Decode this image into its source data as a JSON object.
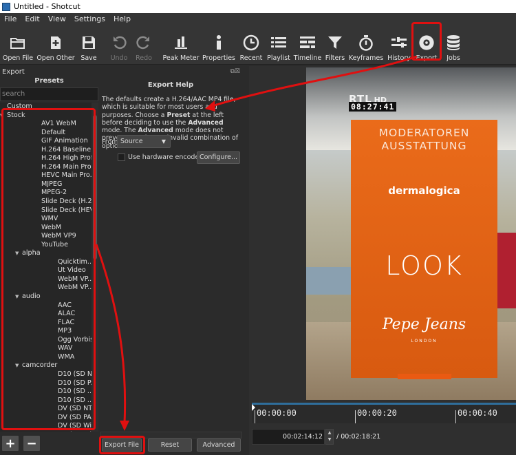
{
  "window": {
    "title": "Untitled - Shotcut"
  },
  "menu": [
    "File",
    "Edit",
    "View",
    "Settings",
    "Help"
  ],
  "toolbar": [
    {
      "label": "Open File",
      "icon": "folder-open-icon",
      "enabled": true
    },
    {
      "label": "Open Other",
      "icon": "open-other-icon",
      "enabled": true
    },
    {
      "label": "Save",
      "icon": "save-icon",
      "enabled": true
    },
    {
      "label": "Undo",
      "icon": "undo-icon",
      "enabled": false
    },
    {
      "label": "Redo",
      "icon": "redo-icon",
      "enabled": false
    },
    {
      "label": "Peak Meter",
      "icon": "peak-meter-icon",
      "enabled": true
    },
    {
      "label": "Properties",
      "icon": "info-icon",
      "enabled": true
    },
    {
      "label": "Recent",
      "icon": "clock-icon",
      "enabled": true
    },
    {
      "label": "Playlist",
      "icon": "list-icon",
      "enabled": true
    },
    {
      "label": "Timeline",
      "icon": "timeline-icon",
      "enabled": true
    },
    {
      "label": "Filters",
      "icon": "funnel-icon",
      "enabled": true
    },
    {
      "label": "Keyframes",
      "icon": "stopwatch-icon",
      "enabled": true
    },
    {
      "label": "History",
      "icon": "history-icon",
      "enabled": true
    },
    {
      "label": "Export",
      "icon": "disc-icon",
      "enabled": true
    },
    {
      "label": "Jobs",
      "icon": "database-icon",
      "enabled": true
    }
  ],
  "export_panel": {
    "dock_title": "Export",
    "presets_header": "Presets",
    "search_placeholder": "search",
    "help_title": "Export Help",
    "help_text": [
      {
        "t": "The defaults create a H.264/AAC MP4 file, which is suitable for most users and purposes. Choose a ",
        "b": false
      },
      {
        "t": "Preset",
        "b": true
      },
      {
        "t": " at the left before deciding to use the ",
        "b": false
      },
      {
        "t": "Advanced",
        "b": true
      },
      {
        "t": " mode. The ",
        "b": false
      },
      {
        "t": "Advanced",
        "b": true
      },
      {
        "t": " mode does not prevent creating an invalid combination of options!",
        "b": false
      }
    ],
    "from_label": "From",
    "from_value": "Source",
    "hw_encoder_label": "Use hardware encoder",
    "configure_label": "Configure...",
    "export_file_label": "Export File",
    "reset_label": "Reset",
    "advanced_label": "Advanced"
  },
  "presets_tree": [
    {
      "label": "Custom",
      "level": 0,
      "arrow": ""
    },
    {
      "label": "Stock",
      "level": 0,
      "arrow": "▼"
    },
    {
      "label": "AV1 WebM",
      "level": 2,
      "arrow": ""
    },
    {
      "label": "Default",
      "level": 2,
      "arrow": ""
    },
    {
      "label": "GIF Animation",
      "level": 2,
      "arrow": ""
    },
    {
      "label": "H.264 Baseline ...",
      "level": 2,
      "arrow": ""
    },
    {
      "label": "H.264 High Prof...",
      "level": 2,
      "arrow": ""
    },
    {
      "label": "H.264 Main Pro...",
      "level": 2,
      "arrow": ""
    },
    {
      "label": "HEVC Main Pro...",
      "level": 2,
      "arrow": ""
    },
    {
      "label": "MJPEG",
      "level": 2,
      "arrow": ""
    },
    {
      "label": "MPEG-2",
      "level": 2,
      "arrow": ""
    },
    {
      "label": "Slide Deck (H.2...",
      "level": 2,
      "arrow": ""
    },
    {
      "label": "Slide Deck (HEV...",
      "level": 2,
      "arrow": ""
    },
    {
      "label": "WMV",
      "level": 2,
      "arrow": ""
    },
    {
      "label": "WebM",
      "level": 2,
      "arrow": ""
    },
    {
      "label": "WebM VP9",
      "level": 2,
      "arrow": ""
    },
    {
      "label": "YouTube",
      "level": 2,
      "arrow": ""
    },
    {
      "label": "alpha",
      "level": 1,
      "arrow": "▼"
    },
    {
      "label": "Quicktim...",
      "level": 3,
      "arrow": ""
    },
    {
      "label": "Ut Video",
      "level": 3,
      "arrow": ""
    },
    {
      "label": "WebM VP...",
      "level": 3,
      "arrow": ""
    },
    {
      "label": "WebM VP...",
      "level": 3,
      "arrow": ""
    },
    {
      "label": "audio",
      "level": 1,
      "arrow": "▼"
    },
    {
      "label": "AAC",
      "level": 3,
      "arrow": ""
    },
    {
      "label": "ALAC",
      "level": 3,
      "arrow": ""
    },
    {
      "label": "FLAC",
      "level": 3,
      "arrow": ""
    },
    {
      "label": "MP3",
      "level": 3,
      "arrow": ""
    },
    {
      "label": "Ogg Vorbis",
      "level": 3,
      "arrow": ""
    },
    {
      "label": "WAV",
      "level": 3,
      "arrow": ""
    },
    {
      "label": "WMA",
      "level": 3,
      "arrow": ""
    },
    {
      "label": "camcorder",
      "level": 1,
      "arrow": "▼"
    },
    {
      "label": "D10 (SD N...",
      "level": 3,
      "arrow": ""
    },
    {
      "label": "D10 (SD P...",
      "level": 3,
      "arrow": ""
    },
    {
      "label": "D10 (SD ...",
      "level": 3,
      "arrow": ""
    },
    {
      "label": "D10 (SD ...",
      "level": 3,
      "arrow": ""
    },
    {
      "label": "DV (SD NT...",
      "level": 3,
      "arrow": ""
    },
    {
      "label": "DV (SD PAL)",
      "level": 3,
      "arrow": ""
    },
    {
      "label": "DV (SD Wi...",
      "level": 3,
      "arrow": ""
    },
    {
      "label": "DV (SD Wi...",
      "level": 3,
      "arrow": ""
    }
  ],
  "preview": {
    "channel_logo": "RTL",
    "channel_suffix": "HD",
    "clock": "08:27:41",
    "banner_line1": "MODERATOREN",
    "banner_line2": "AUSSTATTUNG",
    "brand1": "dermalogica",
    "brand2": "LOOK",
    "brand3": "Pepe Jeans",
    "brand3_sub": "LONDON"
  },
  "timeline": {
    "ruler_labels": [
      "00:00:00",
      "00:00:20",
      "00:00:40"
    ],
    "current_timecode": "00:02:14:12",
    "duration": "/ 00:02:18:21"
  },
  "colors": {
    "highlight": "#e01010",
    "accent": "#2f6e9c",
    "banner": "#e8681a"
  }
}
